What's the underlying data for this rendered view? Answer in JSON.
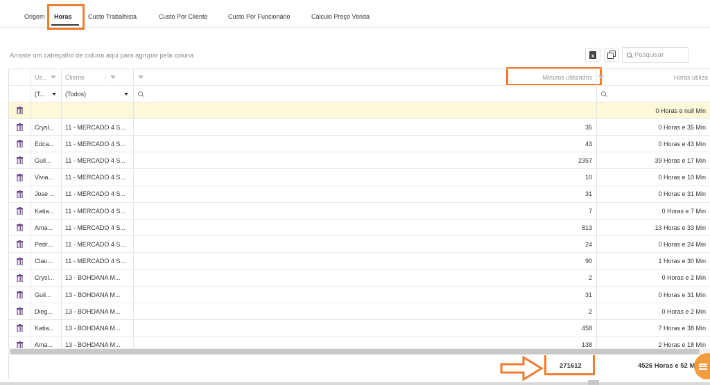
{
  "tabs": [
    {
      "label": "Origem"
    },
    {
      "label": "Horas"
    },
    {
      "label": "Custo Trabalhista"
    },
    {
      "label": "Custo Por Cliente"
    },
    {
      "label": "Custo Por Funcionário"
    },
    {
      "label": "Cálculo Preço Venda"
    }
  ],
  "group_panel_text": "Arraste um cabeçalho de coluna aqui para agrupar pela coluna",
  "search": {
    "placeholder": "Pesquisar"
  },
  "columns": {
    "usuario": "Us...",
    "cliente": "Cliente",
    "minutos": "Minutos utilizados",
    "horas": "Horas utiliza"
  },
  "filters": {
    "usuario": "(T...",
    "cliente": "(Todos)"
  },
  "new_row": {
    "horas": "0 Horas e null Min"
  },
  "rows": [
    {
      "usuario": "Crysl...",
      "cliente": "11 - MERCADO 4 S...",
      "minutos": "35",
      "horas": "0 Horas e 35 Min"
    },
    {
      "usuario": "Edca...",
      "cliente": "11 - MERCADO 4 S...",
      "minutos": "43",
      "horas": "0 Horas e 43 Min"
    },
    {
      "usuario": "Guil...",
      "cliente": "11 - MERCADO 4 S...",
      "minutos": "2357",
      "horas": "39 Horas e 17 Min"
    },
    {
      "usuario": "Vivia...",
      "cliente": "11 - MERCADO 4 S...",
      "minutos": "10",
      "horas": "0 Horas e 10 Min"
    },
    {
      "usuario": "Jose ...",
      "cliente": "11 - MERCADO 4 S...",
      "minutos": "31",
      "horas": "0 Horas e 31 Min"
    },
    {
      "usuario": "Katia...",
      "cliente": "11 - MERCADO 4 S...",
      "minutos": "7",
      "horas": "0 Horas e 7 Min"
    },
    {
      "usuario": "Ama...",
      "cliente": "11 - MERCADO 4 S...",
      "minutos": "813",
      "horas": "13 Horas e 33 Min"
    },
    {
      "usuario": "Pedr...",
      "cliente": "11 - MERCADO 4 S...",
      "minutos": "24",
      "horas": "0 Horas e 24 Min"
    },
    {
      "usuario": "Clau...",
      "cliente": "11 - MERCADO 4 S...",
      "minutos": "90",
      "horas": "1 Horas e 30 Min"
    },
    {
      "usuario": "Crysl...",
      "cliente": "13 - BOHDANA M...",
      "minutos": "2",
      "horas": "0 Horas e 2 Min"
    },
    {
      "usuario": "Guil...",
      "cliente": "13 - BOHDANA M...",
      "minutos": "31",
      "horas": "0 Horas e 31 Min"
    },
    {
      "usuario": "Dieg...",
      "cliente": "13 - BOHDANA M...",
      "minutos": "2",
      "horas": "0 Horas e 2 Min"
    },
    {
      "usuario": "Katia...",
      "cliente": "13 - BOHDANA M...",
      "minutos": "458",
      "horas": "7 Horas e 38 Min"
    },
    {
      "usuario": "Ama...",
      "cliente": "13 - BOHDANA M...",
      "minutos": "138",
      "horas": "2 Horas e 18 Min"
    }
  ],
  "totals": {
    "minutos": "271612",
    "horas": "4526 Horas e 52 M"
  },
  "colors": {
    "highlight": "#ef7d2e",
    "new_row_bg": "#fdf8d8",
    "fab": "#f39c3d"
  }
}
